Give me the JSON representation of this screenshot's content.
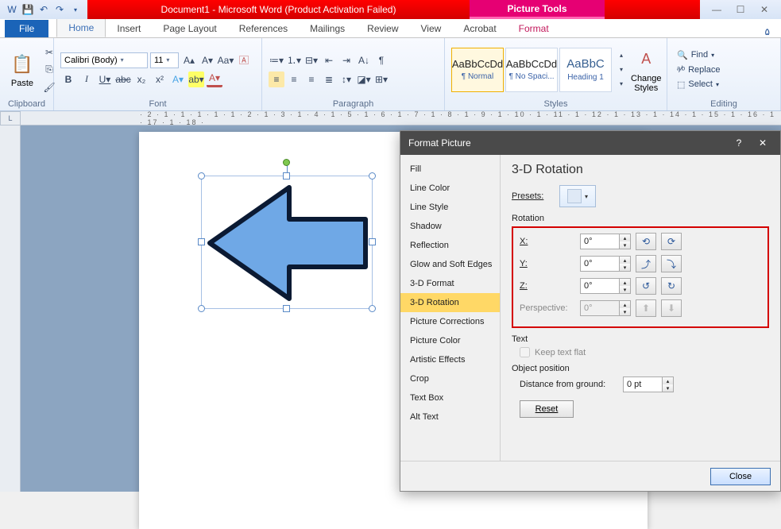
{
  "titlebar": {
    "title": "Document1 - Microsoft Word (Product Activation Failed)",
    "context_tab": "Picture Tools"
  },
  "tabs": {
    "file": "File",
    "list": [
      "Home",
      "Insert",
      "Page Layout",
      "References",
      "Mailings",
      "Review",
      "View",
      "Acrobat",
      "Format"
    ],
    "active": "Home"
  },
  "ribbon": {
    "clipboard": {
      "paste": "Paste",
      "label": "Clipboard"
    },
    "font": {
      "name": "Calibri (Body)",
      "size": "11",
      "label": "Font"
    },
    "paragraph": {
      "label": "Paragraph"
    },
    "styles": {
      "label": "Styles",
      "items": [
        {
          "preview": "AaBbCcDd",
          "name": "¶ Normal"
        },
        {
          "preview": "AaBbCcDd",
          "name": "¶ No Spaci..."
        },
        {
          "preview": "AaBbC",
          "name": "Heading 1"
        }
      ],
      "change": "Change Styles"
    },
    "editing": {
      "label": "Editing",
      "find": "Find",
      "replace": "Replace",
      "select": "Select"
    }
  },
  "ruler": "· 2 · 1 · 1 · 1 · 1 · 1 · 2 · 1 · 3 · 1 · 4 · 1 · 5 · 1 · 6 · 1 · 7 · 1 · 8 · 1 · 9 · 1 · 10 · 1 · 11 · 1 · 12 · 1 · 13 · 1 · 14 · 1 · 15 · 1 · 16 · 1 · 17 · 1 · 18 ·",
  "dialog": {
    "title": "Format Picture",
    "side_items": [
      "Fill",
      "Line Color",
      "Line Style",
      "Shadow",
      "Reflection",
      "Glow and Soft Edges",
      "3-D Format",
      "3-D Rotation",
      "Picture Corrections",
      "Picture Color",
      "Artistic Effects",
      "Crop",
      "Text Box",
      "Alt Text"
    ],
    "side_selected": "3-D Rotation",
    "heading": "3-D Rotation",
    "presets_label": "Presets:",
    "rotation_label": "Rotation",
    "x_label": "X:",
    "x_val": "0°",
    "y_label": "Y:",
    "y_val": "0°",
    "z_label": "Z:",
    "z_val": "0°",
    "persp_label": "Perspective:",
    "persp_val": "0°",
    "text_label": "Text",
    "keep_flat": "Keep text flat",
    "objpos_label": "Object position",
    "dist_label": "Distance from ground:",
    "dist_val": "0 pt",
    "reset": "Reset",
    "close": "Close"
  }
}
